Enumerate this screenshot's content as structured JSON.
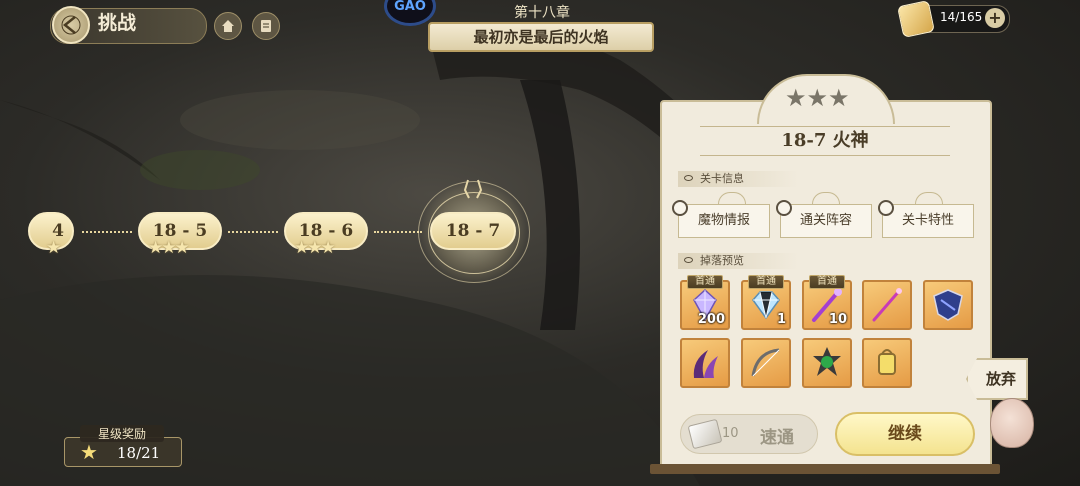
{
  "header": {
    "title": "挑战",
    "chapter_badge": "GAO",
    "chapter_number": "第十八章",
    "chapter_name": "最初亦是最后的火焰",
    "stamina": "14/165",
    "stamina_plus": "+"
  },
  "stages": [
    {
      "label": "4",
      "stars": "★"
    },
    {
      "label": "18 - 5",
      "stars": "★★★"
    },
    {
      "label": "18 - 6",
      "stars": "★★★"
    },
    {
      "label": "18 - 7",
      "stars": ""
    }
  ],
  "star_reward": {
    "label": "星级奖励",
    "icon": "★",
    "count": "18/21"
  },
  "panel": {
    "stars": "★★★",
    "stage_title": "18-7 火神",
    "info_section": "关卡信息",
    "info_buttons": [
      "魔物情报",
      "通关阵容",
      "关卡特性"
    ],
    "drop_section": "掉落预览",
    "first_clear_tag": "首通",
    "drops_row1": [
      {
        "name": "crystal-icon",
        "count": "200",
        "first": true,
        "color": "#c9b7ff"
      },
      {
        "name": "diamond-icon",
        "count": "1",
        "first": true,
        "color": "#bfe6ff"
      },
      {
        "name": "wand-icon",
        "count": "10",
        "first": true,
        "color": "#a43fd1"
      },
      {
        "name": "staff-icon",
        "count": "",
        "first": false,
        "color": "#c83bb8"
      },
      {
        "name": "shield-icon",
        "count": "",
        "first": false,
        "color": "#2f3f8c"
      }
    ],
    "drops_row2": [
      {
        "name": "claw-icon",
        "count": "",
        "color": "#5b2b78"
      },
      {
        "name": "bow-icon",
        "count": "",
        "color": "#6c6c6c"
      },
      {
        "name": "gem-icon",
        "count": "",
        "color": "#2da84a"
      },
      {
        "name": "lantern-icon",
        "count": "",
        "color": "#f4dd6a"
      }
    ],
    "sweep_count": "10",
    "sweep_label": "速通",
    "continue_label": "继续",
    "give_up_label": "放弃"
  }
}
